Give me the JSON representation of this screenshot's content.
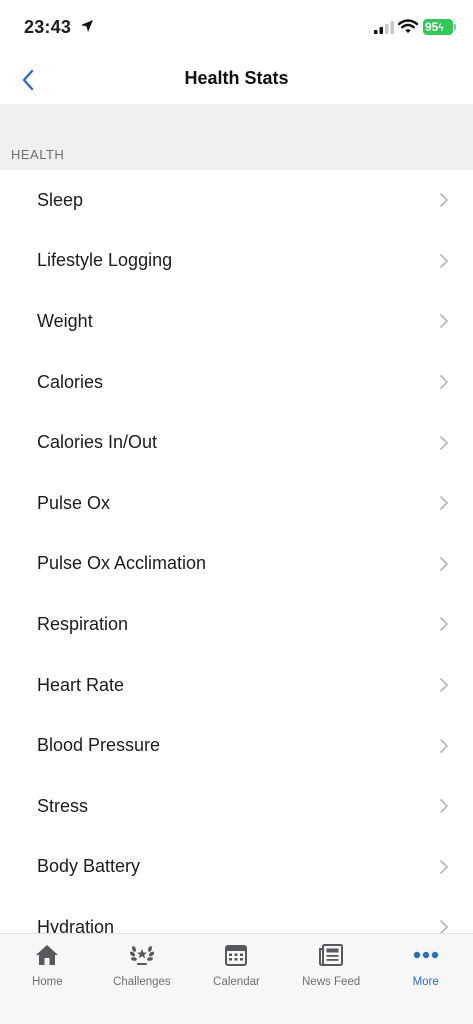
{
  "status_bar": {
    "time": "23:43",
    "battery": "95",
    "battery_color": "#34c759"
  },
  "nav": {
    "title": "Health Stats",
    "back_icon": "chevron-left-icon",
    "accent_color": "#2c6fb6"
  },
  "section": {
    "label": "HEALTH"
  },
  "items": [
    {
      "label": "Sleep"
    },
    {
      "label": "Lifestyle Logging"
    },
    {
      "label": "Weight"
    },
    {
      "label": "Calories"
    },
    {
      "label": "Calories In/Out"
    },
    {
      "label": "Pulse Ox"
    },
    {
      "label": "Pulse Ox Acclimation"
    },
    {
      "label": "Respiration"
    },
    {
      "label": "Heart Rate"
    },
    {
      "label": "Blood Pressure"
    },
    {
      "label": "Stress"
    },
    {
      "label": "Body Battery"
    },
    {
      "label": "Hydration"
    }
  ],
  "tabs": [
    {
      "label": "Home",
      "icon": "home-icon"
    },
    {
      "label": "Challenges",
      "icon": "laurel-icon"
    },
    {
      "label": "Calendar",
      "icon": "calendar-icon"
    },
    {
      "label": "News Feed",
      "icon": "newspaper-icon"
    },
    {
      "label": "More",
      "icon": "more-dots-icon",
      "active": true
    }
  ]
}
